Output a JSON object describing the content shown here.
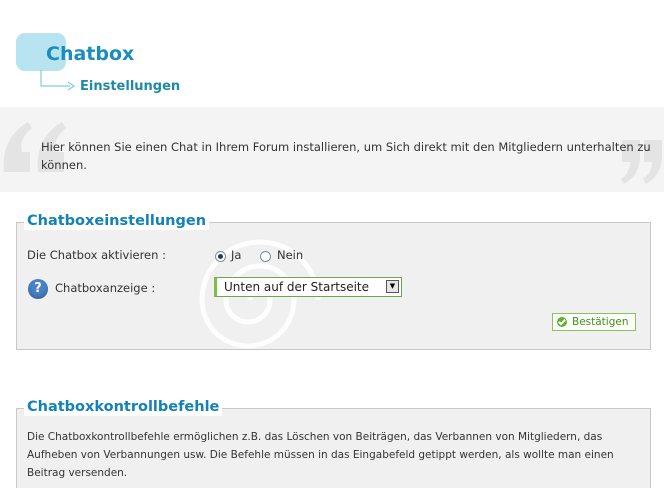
{
  "header": {
    "title": "Chatbox",
    "subtitle": "Einstellungen"
  },
  "intro": {
    "text": "Hier können Sie einen Chat in Ihrem Forum installieren, um Sich direkt mit den Mitgliedern unterhalten zu können."
  },
  "settings": {
    "legend": "Chatboxeinstellungen",
    "activate_label": "Die Chatbox aktivieren :",
    "radio_yes": "Ja",
    "radio_no": "Nein",
    "selected": "Ja",
    "display_label": "Chatboxanzeige :",
    "display_value": "Unten auf der Startseite",
    "confirm_label": "Bestätigen"
  },
  "commands": {
    "legend": "Chatboxkontrollbefehle",
    "text": "Die Chatboxkontrollbefehle ermöglichen z.B. das Löschen von Beiträgen, das Verbannen von Mitgliedern, das Aufheben von Verbannungen usw. Die Befehle müssen in das Eingabefeld getippt werden, als wollte man einen Beitrag versenden."
  },
  "colors": {
    "title": "#1a8cc0",
    "legend": "#1282b8",
    "accent_green": "#7ac143"
  }
}
